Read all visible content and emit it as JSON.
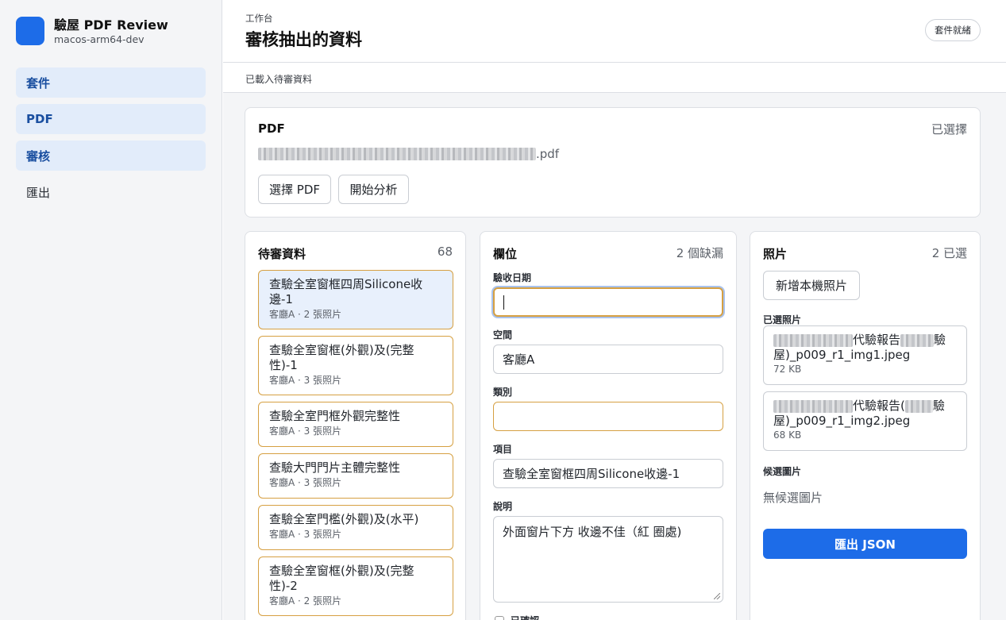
{
  "app": {
    "title": "驗屋 PDF Review",
    "subtitle": "macos-arm64-dev",
    "accent": "#1d6ce8"
  },
  "sidebar": {
    "items": [
      {
        "label": "套件",
        "active": true
      },
      {
        "label": "PDF",
        "active": true
      },
      {
        "label": "審核",
        "active": true
      },
      {
        "label": "匯出",
        "active": false
      }
    ]
  },
  "header": {
    "eyebrow": "工作台",
    "title": "審核抽出的資料",
    "status": "套件就緒"
  },
  "subbar": {
    "text": "已載入待審資料"
  },
  "pdf": {
    "title": "PDF",
    "state": "已選擇",
    "file_suffix": ".pdf",
    "select_button": "選擇 PDF",
    "analyze_button": "開始分析"
  },
  "review": {
    "title": "待審資料",
    "count": "68",
    "items": [
      {
        "title": "查驗全室窗框四周Silicone收邊-1",
        "meta": "客廳A · 2 張照片"
      },
      {
        "title": "查驗全室窗框(外觀)及(完整性)-1",
        "meta": "客廳A · 3 張照片"
      },
      {
        "title": "查驗全室門框外觀完整性",
        "meta": "客廳A · 3 張照片"
      },
      {
        "title": "查驗大門門片主體完整性",
        "meta": "客廳A · 3 張照片"
      },
      {
        "title": "查驗全室門檻(外觀)及(水平)",
        "meta": "客廳A · 3 張照片"
      },
      {
        "title": "查驗全室窗框(外觀)及(完整性)-2",
        "meta": "客廳A · 2 張照片"
      }
    ]
  },
  "fields": {
    "title": "欄位",
    "missing": "2 個缺漏",
    "date_label": "驗收日期",
    "date_value": "",
    "space_label": "空間",
    "space_value": "客廳A",
    "category_label": "類別",
    "category_value": "",
    "item_label": "項目",
    "item_value": "查驗全室窗框四周Silicone收邊-1",
    "desc_label": "說明",
    "desc_value": "外面窗片下方 收邊不佳（紅 圈處)",
    "confirm_label": "已確認"
  },
  "photos": {
    "title": "照片",
    "selected_count": "2 已選",
    "add_button": "新增本機照片",
    "selected_label": "已選照片",
    "items": [
      {
        "name_a": "代驗報告",
        "name_b": "驗",
        "name_c": "屋)_p009_r1_img1.jpeg",
        "size": "72 KB"
      },
      {
        "name_a": "代驗報告(",
        "name_b": "驗",
        "name_c": "屋)_p009_r1_img2.jpeg",
        "size": "68 KB"
      }
    ],
    "candidates_label": "候選圖片",
    "candidates_empty": "無候選圖片",
    "export_button": "匯出 JSON"
  }
}
